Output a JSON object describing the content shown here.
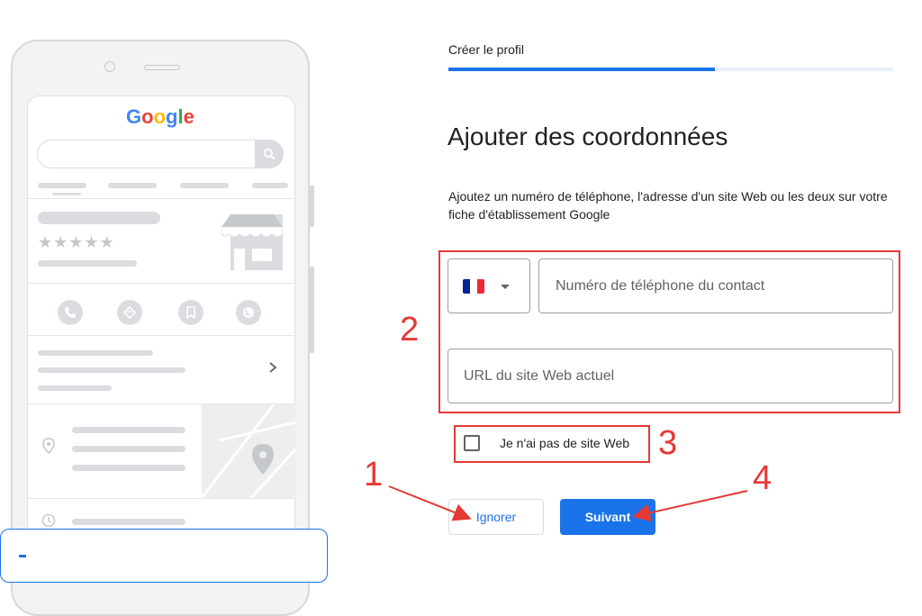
{
  "preview": {
    "logo_text": "Google",
    "logo_letters": [
      {
        "ch": "G",
        "color": "#4285F4"
      },
      {
        "ch": "o",
        "color": "#EA4335"
      },
      {
        "ch": "o",
        "color": "#FBBC05"
      },
      {
        "ch": "g",
        "color": "#4285F4"
      },
      {
        "ch": "l",
        "color": "#34A853"
      },
      {
        "ch": "e",
        "color": "#EA4335"
      }
    ],
    "stars": "★★★★★"
  },
  "stepper": {
    "label": "Créer le profil",
    "progress": 0.6
  },
  "form": {
    "title": "Ajouter des coordonnées",
    "description": "Ajoutez un numéro de téléphone, l'adresse d'un site Web ou les deux sur votre fiche d'établissement Google",
    "country_flag": "France",
    "phone_placeholder": "Numéro de téléphone du contact",
    "website_placeholder": "URL du site Web actuel",
    "no_website_label": "Je n'ai pas de site Web",
    "skip_label": "Ignorer",
    "next_label": "Suivant"
  },
  "annotations": [
    "1",
    "2",
    "3",
    "4"
  ],
  "colors": {
    "accent": "#1a73e8",
    "annotation": "#e53935"
  }
}
